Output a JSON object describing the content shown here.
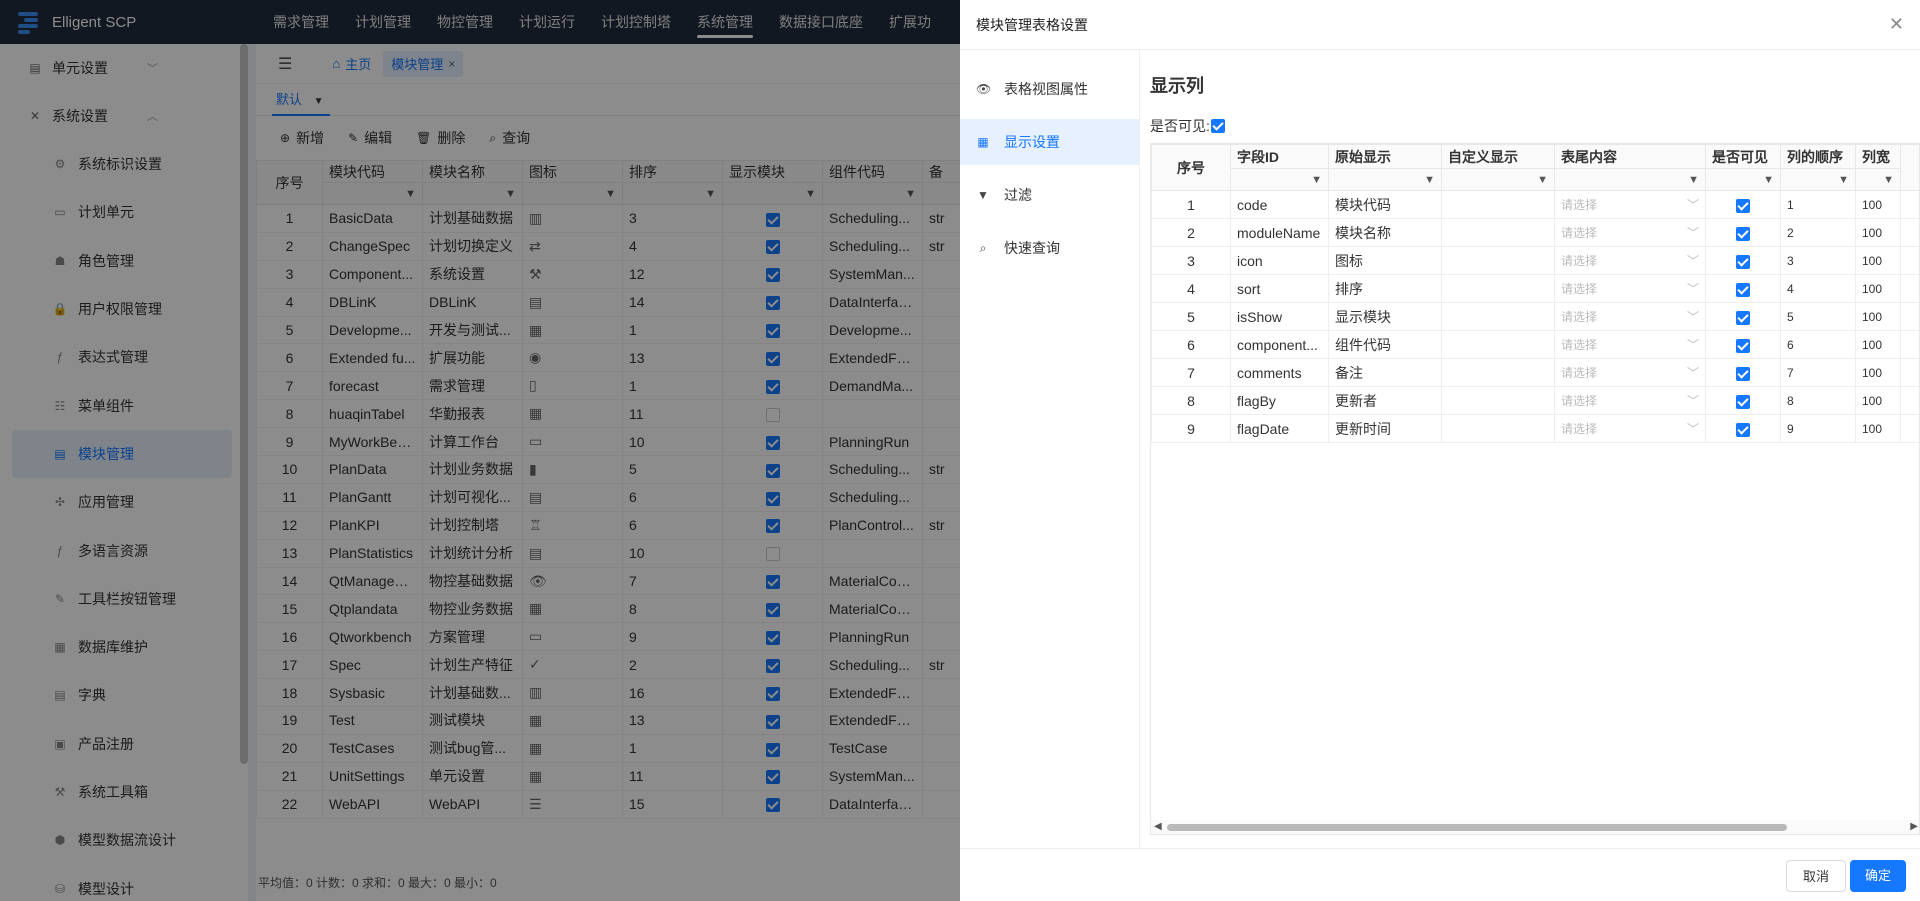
{
  "app": {
    "title": "Elligent SCP"
  },
  "nav": [
    "需求管理",
    "计划管理",
    "物控管理",
    "计划运行",
    "计划控制塔",
    "系统管理",
    "数据接口底座",
    "扩展功"
  ],
  "nav_active_index": 5,
  "sidebar": {
    "group1": "单元设置",
    "group2": "系统设置",
    "items": [
      {
        "label": "系统标识设置",
        "icon": "settings-icon"
      },
      {
        "label": "计划单元",
        "icon": "unit-icon"
      },
      {
        "label": "角色管理",
        "icon": "role-icon"
      },
      {
        "label": "用户权限管理",
        "icon": "lock-icon"
      },
      {
        "label": "表达式管理",
        "icon": "formula-icon"
      },
      {
        "label": "菜单组件",
        "icon": "menu-icon"
      },
      {
        "label": "模块管理",
        "icon": "module-icon"
      },
      {
        "label": "应用管理",
        "icon": "apps-icon"
      },
      {
        "label": "多语言资源",
        "icon": "language-icon"
      },
      {
        "label": "工具栏按钮管理",
        "icon": "toolbar-icon"
      },
      {
        "label": "数据库维护",
        "icon": "database-icon"
      },
      {
        "label": "字典",
        "icon": "dictionary-icon"
      },
      {
        "label": "产品注册",
        "icon": "register-icon"
      },
      {
        "label": "系统工具箱",
        "icon": "toolbox-icon"
      },
      {
        "label": "模型数据流设计",
        "icon": "dataflow-icon"
      },
      {
        "label": "模型设计",
        "icon": "model-icon"
      }
    ]
  },
  "tabs": {
    "home": "主页",
    "current": "模块管理"
  },
  "view": {
    "selected": "默认"
  },
  "toolbar": {
    "add": "新增",
    "edit": "编辑",
    "delete": "删除",
    "query": "查询"
  },
  "grid": {
    "columns": [
      "序号",
      "模块代码",
      "模块名称",
      "图标",
      "排序",
      "显示模块",
      "组件代码",
      "备"
    ],
    "rows": [
      [
        "1",
        "BasicData",
        "计划基础数据",
        "chart-icon",
        "3",
        true,
        "Scheduling...",
        "str"
      ],
      [
        "2",
        "ChangeSpec",
        "计划切换定义",
        "swap-icon",
        "4",
        true,
        "Scheduling...",
        "str"
      ],
      [
        "3",
        "Component...",
        "系统设置",
        "tools-icon",
        "12",
        true,
        "SystemMan...",
        ""
      ],
      [
        "4",
        "DBLinK",
        "DBLinK",
        "db-icon",
        "14",
        true,
        "DataInterfac...",
        ""
      ],
      [
        "5",
        "Developme...",
        "开发与测试...",
        "table-icon",
        "1",
        true,
        "Developme...",
        ""
      ],
      [
        "6",
        "Extended fu...",
        "扩展功能",
        "circle-icon",
        "13",
        true,
        "ExtendedFu...",
        ""
      ],
      [
        "7",
        "forecast",
        "需求管理",
        "doc-icon",
        "1",
        true,
        "DemandMa...",
        ""
      ],
      [
        "8",
        "huaqinTabel",
        "华勤报表",
        "table-icon",
        "11",
        false,
        "",
        ""
      ],
      [
        "9",
        "MyWorkBen...",
        "计算工作台",
        "monitor-icon",
        "10",
        true,
        "PlanningRun",
        ""
      ],
      [
        "10",
        "PlanData",
        "计划业务数据",
        "file-icon",
        "5",
        true,
        "Scheduling...",
        "str"
      ],
      [
        "11",
        "PlanGantt",
        "计划可视化...",
        "gantt-icon",
        "6",
        true,
        "Scheduling...",
        ""
      ],
      [
        "12",
        "PlanKPI",
        "计划控制塔",
        "tower-icon",
        "6",
        true,
        "PlanControl...",
        "str"
      ],
      [
        "13",
        "PlanStatistics",
        "计划统计分析",
        "stats-icon",
        "10",
        false,
        "",
        ""
      ],
      [
        "14",
        "QtManagem...",
        "物控基础数据",
        "eye-icon",
        "7",
        true,
        "MaterialCon...",
        ""
      ],
      [
        "15",
        "Qtplandata",
        "物控业务数据",
        "table-icon",
        "8",
        true,
        "MaterialCon...",
        ""
      ],
      [
        "16",
        "Qtworkbench",
        "方案管理",
        "monitor-icon",
        "9",
        true,
        "PlanningRun",
        ""
      ],
      [
        "17",
        "Spec",
        "计划生产特征",
        "clipboard-icon",
        "2",
        true,
        "Scheduling...",
        "str"
      ],
      [
        "18",
        "Sysbasic",
        "计划基础数...",
        "chart-icon",
        "16",
        true,
        "ExtendedFu...",
        ""
      ],
      [
        "19",
        "Test",
        "测试模块",
        "table-icon",
        "13",
        true,
        "ExtendedFu...",
        ""
      ],
      [
        "20",
        "TestCases",
        "测试bug管...",
        "calendar-icon",
        "1",
        true,
        "TestCase",
        ""
      ],
      [
        "21",
        "UnitSettings",
        "单元设置",
        "grid-icon",
        "11",
        true,
        "SystemMan...",
        ""
      ],
      [
        "22",
        "WebAPI",
        "WebAPI",
        "sliders-icon",
        "15",
        true,
        "DataInterfac...",
        ""
      ]
    ]
  },
  "footer_stats": "平均值：0 计数：0 求和：0 最大：0 最小：0",
  "drawer": {
    "title": "模块管理表格设置",
    "nav": [
      {
        "label": "表格视图属性",
        "icon": "eye-icon"
      },
      {
        "label": "显示设置",
        "icon": "table-icon"
      },
      {
        "label": "过滤",
        "icon": "filter-icon"
      },
      {
        "label": "快速查询",
        "icon": "search-doc-icon"
      }
    ],
    "nav_active_index": 1,
    "section_title": "显示列",
    "visible_label": "是否可见:",
    "columns": [
      "序号",
      "字段ID",
      "原始显示",
      "自定义显示",
      "表尾内容",
      "是否可见",
      "列的顺序",
      "列宽"
    ],
    "select_placeholder": "请选择",
    "rows": [
      {
        "seq": "1",
        "field": "code",
        "orig": "模块代码",
        "order": "1",
        "width": "100"
      },
      {
        "seq": "2",
        "field": "moduleName",
        "orig": "模块名称",
        "order": "2",
        "width": "100"
      },
      {
        "seq": "3",
        "field": "icon",
        "orig": "图标",
        "order": "3",
        "width": "100"
      },
      {
        "seq": "4",
        "field": "sort",
        "orig": "排序",
        "order": "4",
        "width": "100"
      },
      {
        "seq": "5",
        "field": "isShow",
        "orig": "显示模块",
        "order": "5",
        "width": "100"
      },
      {
        "seq": "6",
        "field": "component...",
        "orig": "组件代码",
        "order": "6",
        "width": "100"
      },
      {
        "seq": "7",
        "field": "comments",
        "orig": "备注",
        "order": "7",
        "width": "100"
      },
      {
        "seq": "8",
        "field": "flagBy",
        "orig": "更新者",
        "order": "8",
        "width": "100"
      },
      {
        "seq": "9",
        "field": "flagDate",
        "orig": "更新时间",
        "order": "9",
        "width": "100"
      }
    ],
    "cancel": "取消",
    "ok": "确定"
  },
  "colors": {
    "accent": "#1677ff",
    "topbar": "#1f2d3d"
  }
}
